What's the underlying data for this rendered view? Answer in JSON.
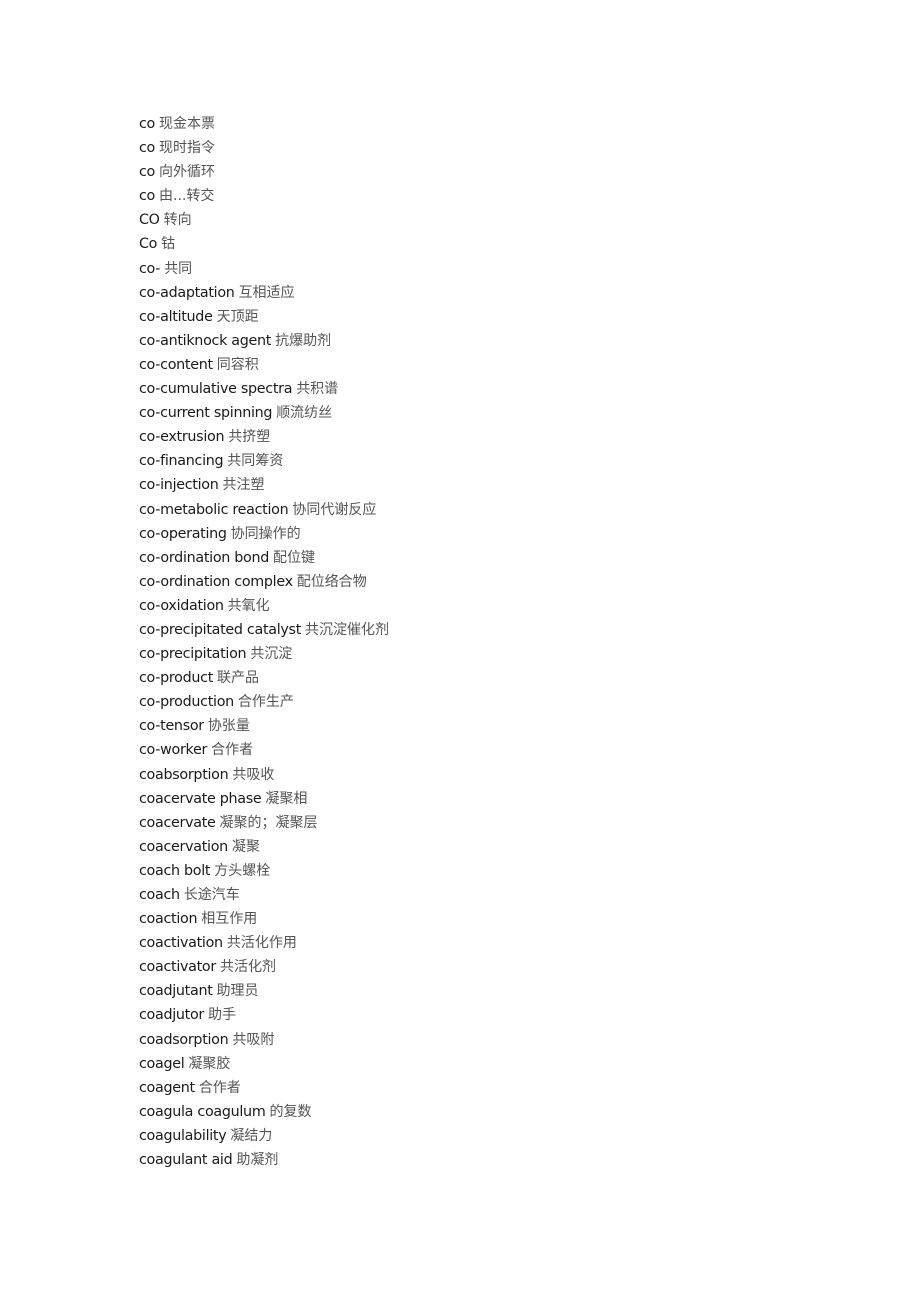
{
  "document": {
    "entries": [
      {
        "term": "co",
        "def": "现金本票"
      },
      {
        "term": "co",
        "def": "现时指令"
      },
      {
        "term": "co",
        "def": "向外循环"
      },
      {
        "term": "co",
        "def": "由...转交"
      },
      {
        "term": "CO",
        "def": "转向"
      },
      {
        "term": "Co",
        "def": "钴"
      },
      {
        "term": "co-",
        "def": "共同"
      },
      {
        "term": "co-adaptation",
        "def": "互相适应"
      },
      {
        "term": "co-altitude",
        "def": "天顶距"
      },
      {
        "term": "co-antiknock agent",
        "def": "抗爆助剂"
      },
      {
        "term": "co-content",
        "def": "同容积"
      },
      {
        "term": "co-cumulative spectra",
        "def": "共积谱"
      },
      {
        "term": "co-current spinning",
        "def": "顺流纺丝"
      },
      {
        "term": "co-extrusion",
        "def": "共挤塑"
      },
      {
        "term": "co-financing",
        "def": "共同筹资"
      },
      {
        "term": "co-injection",
        "def": "共注塑"
      },
      {
        "term": "co-metabolic reaction",
        "def": "协同代谢反应"
      },
      {
        "term": "co-operating",
        "def": "协同操作的"
      },
      {
        "term": "co-ordination bond",
        "def": "配位键"
      },
      {
        "term": "co-ordination complex",
        "def": "配位络合物"
      },
      {
        "term": "co-oxidation",
        "def": "共氧化"
      },
      {
        "term": "co-precipitated catalyst",
        "def": "共沉淀催化剂"
      },
      {
        "term": "co-precipitation",
        "def": "共沉淀"
      },
      {
        "term": "co-product",
        "def": "联产品"
      },
      {
        "term": "co-production",
        "def": "合作生产"
      },
      {
        "term": "co-tensor",
        "def": "协张量"
      },
      {
        "term": "co-worker",
        "def": "合作者"
      },
      {
        "term": "coabsorption",
        "def": "共吸收"
      },
      {
        "term": "coacervate phase",
        "def": "凝聚相"
      },
      {
        "term": "coacervate",
        "def": "凝聚的；凝聚层"
      },
      {
        "term": "coacervation",
        "def": "凝聚"
      },
      {
        "term": "coach bolt",
        "def": "方头螺栓"
      },
      {
        "term": "coach",
        "def": "长途汽车"
      },
      {
        "term": "coaction",
        "def": "相互作用"
      },
      {
        "term": "coactivation",
        "def": "共活化作用"
      },
      {
        "term": "coactivator",
        "def": "共活化剂"
      },
      {
        "term": "coadjutant",
        "def": "助理员"
      },
      {
        "term": "coadjutor",
        "def": "助手"
      },
      {
        "term": "coadsorption",
        "def": "共吸附"
      },
      {
        "term": "coagel",
        "def": "凝聚胶"
      },
      {
        "term": "coagent",
        "def": "合作者"
      },
      {
        "term": "coagula coagulum",
        "def": "的复数"
      },
      {
        "term": "coagulability",
        "def": "凝结力"
      },
      {
        "term": "coagulant aid",
        "def": "助凝剂"
      }
    ]
  }
}
